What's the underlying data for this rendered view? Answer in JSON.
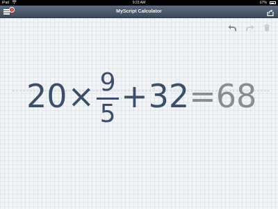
{
  "status_bar": {
    "device": "iPad",
    "time": "9:23 AM",
    "battery": "67%"
  },
  "nav": {
    "title": "MyScript Calculator",
    "badge_count": "1",
    "icons": [
      "menu-icon",
      "share-icon"
    ]
  },
  "toolbar": {
    "icons": [
      "undo-icon",
      "redo-icon",
      "trash-icon"
    ]
  },
  "equation": {
    "whole": "20",
    "times": "×",
    "numerator": "9",
    "denominator": "5",
    "plus": "+",
    "addend": "32",
    "equals": "=",
    "result": "68"
  },
  "colors": {
    "handwriting": "#3a4f6b",
    "result": "#8c8c8c",
    "nav_top": "#5f6f83",
    "nav_bottom": "#3a485a"
  }
}
